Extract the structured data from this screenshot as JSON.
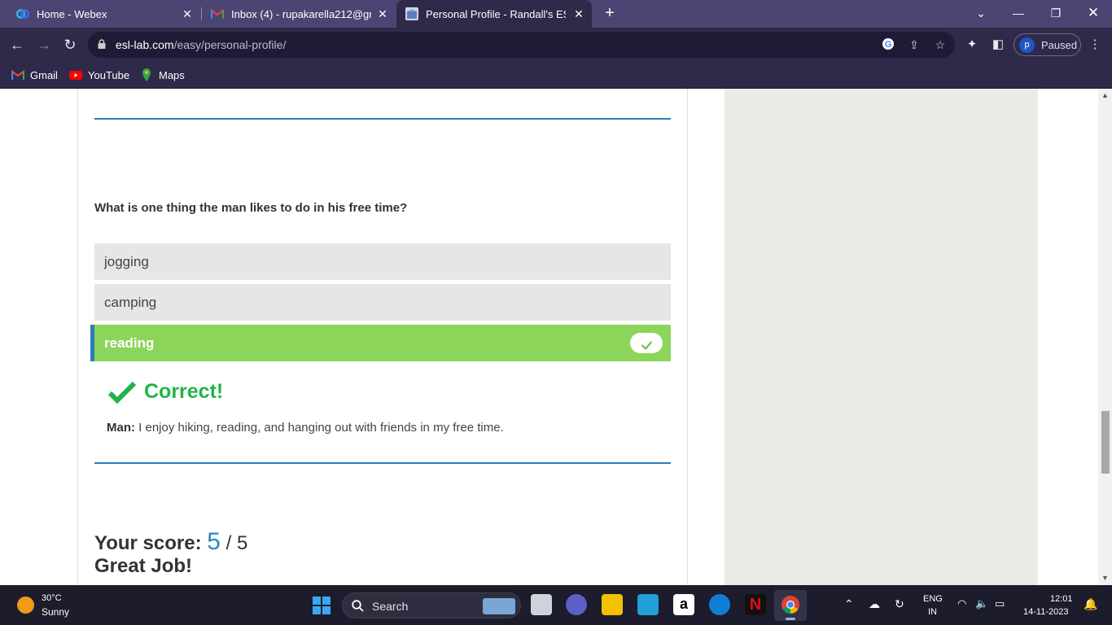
{
  "tabs": [
    {
      "title": "Home - Webex",
      "icon": "webex-icon",
      "active": false
    },
    {
      "title": "Inbox (4) - rupakarella212@gma",
      "icon": "gmail-icon",
      "active": false
    },
    {
      "title": "Personal Profile - Randall's ESL C",
      "icon": "esl-lab-icon",
      "active": true
    }
  ],
  "address_bar": {
    "host": "esl-lab.com",
    "path": "/easy/personal-profile/"
  },
  "profile": {
    "initial": "p",
    "status": "Paused"
  },
  "bookmarks": [
    {
      "label": "Gmail",
      "icon": "gmail-icon"
    },
    {
      "label": "YouTube",
      "icon": "youtube-icon"
    },
    {
      "label": "Maps",
      "icon": "maps-icon"
    }
  ],
  "quiz": {
    "question": "What is one thing the man likes to do in his free time?",
    "options": [
      {
        "label": "jogging",
        "state": "default"
      },
      {
        "label": "camping",
        "state": "default"
      },
      {
        "label": "reading",
        "state": "correct"
      }
    ],
    "result_label": "Correct!",
    "feedback_speaker": "Man:",
    "feedback_text": " I enjoy hiking, reading, and hanging out with friends in my free time.",
    "score_label": "Your score:",
    "score_value": "5",
    "score_total": "/ 5",
    "praise": "Great Job!"
  },
  "colors": {
    "correct_bg": "#8cd55b",
    "correct_text": "#22b34a",
    "accent_blue": "#2b7cb7",
    "tabstrip": "#4b4573"
  },
  "taskbar": {
    "weather_temp": "30°C",
    "weather_cond": "Sunny",
    "search_label": "Search",
    "lang": "ENG",
    "region": "IN",
    "time": "12:01",
    "date": "14-11-2023"
  }
}
